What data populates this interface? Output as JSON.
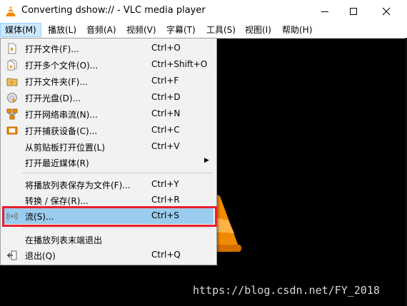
{
  "window": {
    "title": "Converting dshow:// - VLC media player",
    "minimize_glyph": "—",
    "maximize_glyph": "☐",
    "close_glyph": "✕"
  },
  "menubar": [
    {
      "label": "媒体(M)"
    },
    {
      "label": "播放(L)"
    },
    {
      "label": "音频(A)"
    },
    {
      "label": "视频(V)"
    },
    {
      "label": "字幕(T)"
    },
    {
      "label": "工具(S)"
    },
    {
      "label": "视图(I)"
    },
    {
      "label": "帮助(H)"
    }
  ],
  "media_menu": [
    {
      "label": "打开文件(F)...",
      "shortcut": "Ctrl+O",
      "icon": "file-icon"
    },
    {
      "label": "打开多个文件(O)...",
      "shortcut": "Ctrl+Shift+O",
      "icon": "files-icon"
    },
    {
      "label": "打开文件夹(F)...",
      "shortcut": "Ctrl+F",
      "icon": "folder-icon"
    },
    {
      "label": "打开光盘(D)...",
      "shortcut": "Ctrl+D",
      "icon": "disc-icon"
    },
    {
      "label": "打开网络串流(N)...",
      "shortcut": "Ctrl+N",
      "icon": "network-icon"
    },
    {
      "label": "打开捕获设备(C)...",
      "shortcut": "Ctrl+C",
      "icon": "capture-device-icon"
    },
    {
      "label": "从剪贴板打开位置(L)",
      "shortcut": "Ctrl+V",
      "icon": ""
    },
    {
      "label": "打开最近媒体(R)",
      "shortcut": "",
      "icon": "",
      "submenu": true
    },
    {
      "label": "将播放列表保存为文件(F)...",
      "shortcut": "Ctrl+Y",
      "icon": ""
    },
    {
      "label": "转换 / 保存(R)...",
      "shortcut": "Ctrl+R",
      "icon": ""
    },
    {
      "label": "流(S)...",
      "shortcut": "Ctrl+S",
      "icon": "stream-icon",
      "highlighted": true
    },
    {
      "label": "在播放列表末端退出",
      "shortcut": "",
      "icon": ""
    },
    {
      "label": "退出(Q)",
      "shortcut": "Ctrl+Q",
      "icon": "exit-icon"
    }
  ],
  "watermark": "https://blog.csdn.net/FY_2018",
  "colors": {
    "highlight": "#99ccee",
    "annotation_box": "#e8202b",
    "vlc_orange": "#f08a00"
  }
}
